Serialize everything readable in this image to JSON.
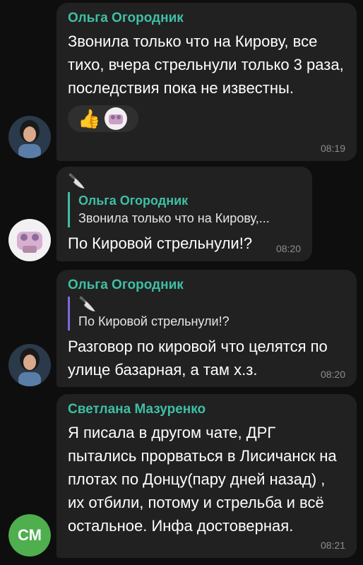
{
  "messages": [
    {
      "sender": "Ольга Огородник",
      "text": "Звонила только что на Кирову, все тихо, вчера стрельнули только 3 раза, последствия пока не известны.",
      "time": "08:19",
      "reaction_emoji": "👍"
    },
    {
      "sticker": "🔪",
      "reply_name": "Ольга Огородник",
      "reply_text": "Звонила только что на Кирову,...",
      "text": "По Кировой стрельнули!?",
      "time": "08:20"
    },
    {
      "sender": "Ольга Огородник",
      "reply_sticker": "🔪",
      "reply_text": "По Кировой стрельнули!?",
      "text": "Разговор по кировой что целятся по улице базарная, а там х.з.",
      "time": "08:20"
    },
    {
      "sender": "Светлана Мазуренко",
      "text": "Я писала в другом чате, ДРГ пытались прорваться в Лисичанск на плотах по Донцу(пару дней назад) , их отбили, потому и стрельба и всё остальное. Инфа достоверная.",
      "time": "08:21",
      "avatar_initials": "СМ",
      "avatar_color": "#4fae4e"
    }
  ],
  "colors": {
    "background": "#0e0e0e",
    "bubble": "#212121",
    "sender_name": "#3fbfa4",
    "reply_bar_alt": "#7b6cd9",
    "time": "#8d8d8d"
  }
}
